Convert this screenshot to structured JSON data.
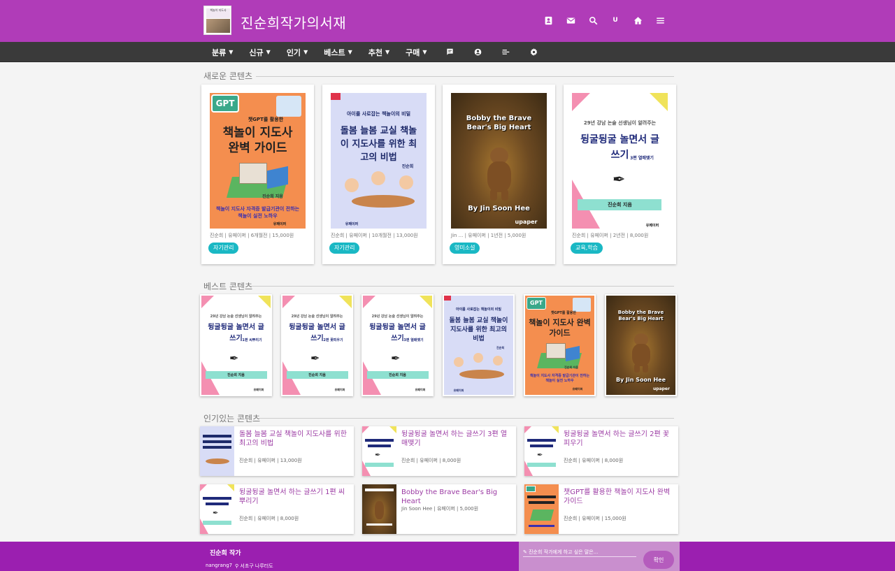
{
  "header": {
    "site_title": "진순희작가의서재",
    "logo_text": "책놀이 지도사",
    "icons": [
      "contact-card-icon",
      "mail-icon",
      "search-icon",
      "user-u-icon",
      "home-icon",
      "menu-icon"
    ],
    "user_initial": "U"
  },
  "nav": {
    "items": [
      {
        "label": "분류"
      },
      {
        "label": "신규"
      },
      {
        "label": "인기"
      },
      {
        "label": "베스트"
      },
      {
        "label": "추천"
      },
      {
        "label": "구매"
      }
    ],
    "icons": [
      "comment-icon",
      "account-icon",
      "sort-icon",
      "settings-icon"
    ]
  },
  "sections": {
    "new": "새로운 콘텐츠",
    "best": "베스트 콘텐츠",
    "popular": "인기있는 콘텐츠"
  },
  "new_contents": [
    {
      "meta": "진순희 | 유페이퍼 | 6개월전 | 15,000원",
      "tag": "자기관리",
      "cover": {
        "top": "챗GPT를 활용한",
        "title": "책놀이 지도사 완벽 가이드",
        "sub": "책놀이 지도사 자격증 발급기관이 전하는 책놀이 실전 노하우",
        "author": "진순희 지음",
        "publisher": "유페이퍼",
        "badge": "GPT"
      }
    },
    {
      "meta": "진순희 | 유페이퍼 | 10개월전 | 13,000원",
      "tag": "자기관리",
      "cover": {
        "top": "아이를 사로잡는 책놀이의 비밀",
        "title": "돌봄 늘봄 교실 책놀이 지도사를 위한 최고의 비법",
        "author": "진순희",
        "publisher": "유페이퍼"
      }
    },
    {
      "meta": "Jin ... | 유페이퍼 | 1년전 | 5,000원",
      "tag": "영미소설",
      "cover": {
        "title": "Bobby the Brave Bear's Big Heart",
        "author": "By Jin Soon Hee",
        "publisher": "upaper"
      }
    },
    {
      "meta": "진순희 | 유페이퍼 | 2년전 | 8,000원",
      "tag": "교육,학습",
      "cover": {
        "top": "29년 강남 논술 선생님이 알려주는",
        "title": "뒹굴뒹굴 놀면서 글쓰기",
        "vol": "3편 열매맺기",
        "author": "진순희 지음",
        "publisher": "유페이퍼"
      }
    }
  ],
  "best_contents": [
    {
      "cover": {
        "top": "29년 강남 논술 선생님이 알려주는",
        "title": "뒹굴뒹굴 놀면서 글쓰기",
        "vol": "1편 씨뿌리기",
        "author": "진순희 지음",
        "publisher": "유페이퍼"
      }
    },
    {
      "cover": {
        "top": "29년 강남 논술 선생님이 알려주는",
        "title": "뒹굴뒹굴 놀면서 글쓰기",
        "vol": "2편 꽃피우기",
        "author": "진순희 지음",
        "publisher": "유페이퍼"
      }
    },
    {
      "cover": {
        "top": "29년 강남 논술 선생님이 알려주는",
        "title": "뒹굴뒹굴 놀면서 글쓰기",
        "vol": "3편 열매맺기",
        "author": "진순희 지음",
        "publisher": "유페이퍼"
      }
    },
    {
      "cover": {
        "top": "아이를 사로잡는 책놀이의 비밀",
        "title": "돌봄 늘봄 교실 책놀이 지도사를 위한 최고의 비법",
        "author": "진순희",
        "publisher": "유페이퍼"
      }
    },
    {
      "cover": {
        "top": "챗GPT를 활용한",
        "title": "책놀이 지도사 완벽 가이드",
        "sub": "책놀이 지도사 자격증 발급기관이 전하는 책놀이 실전 노하우",
        "author": "진순희 지음",
        "publisher": "유페이퍼",
        "badge": "GPT"
      }
    },
    {
      "cover": {
        "title": "Bobby the Brave Bear's Big Heart",
        "author": "By Jin Soon Hee",
        "publisher": "upaper"
      }
    }
  ],
  "popular_contents": [
    {
      "title": "돌봄 늘봄 교실 책놀이 지도사를 위한 최고의 비법",
      "meta": "진순희 | 유페이퍼 | 13,000원",
      "thumb": "blue"
    },
    {
      "title": "뒹굴뒹굴 놀면서 하는 글쓰기 3편 열매맺기",
      "meta": "진순희 | 유페이퍼 | 8,000원",
      "thumb": "pink"
    },
    {
      "title": "뒹굴뒹굴 놀면서 하는 글쓰기 2편 꽃피우기",
      "meta": "진순희 | 유페이퍼 | 8,000원",
      "thumb": "pink"
    },
    {
      "title": "뒹굴뒹굴 놀면서 하는 글쓰기 1편 씨뿌리기",
      "meta": "진순희 | 유페이퍼 | 8,000원",
      "thumb": "pink"
    },
    {
      "title": "Bobby the Brave Bear's Big Heart",
      "meta": "Jin Soon Hee | 유페이퍼 | 5,000원",
      "thumb": "bear"
    },
    {
      "title": "챗GPT를 활용한 책놀이 지도사 완벽 가이드",
      "meta": "진순희 | 유페이퍼 | 15,000원",
      "thumb": "orange"
    }
  ],
  "footer": {
    "author_name": "진순희 작가",
    "user_id": "nangrang7",
    "location": "서초구 나루터도",
    "message_placeholder": "✎ 진순희 작가에게 하고 싶은 말은...",
    "confirm_label": "확인"
  },
  "colors": {
    "header": "#b03cb8",
    "navbar": "#3a3a3a",
    "footer": "#9b1fb0",
    "tag": "#1ab8c4",
    "link": "#9b3aa3"
  }
}
